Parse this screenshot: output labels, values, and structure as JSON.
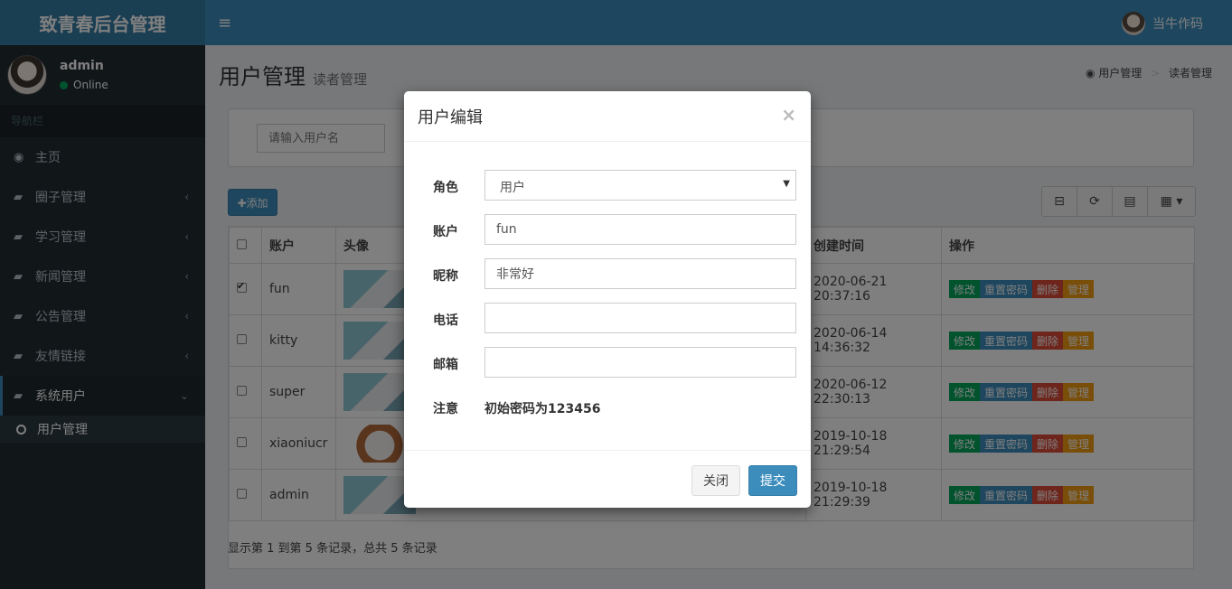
{
  "app": {
    "logo": "致青春后台管理",
    "top_user": "当牛作码"
  },
  "sidebar": {
    "user_name": "admin",
    "user_status": "Online",
    "nav_header": "导航栏",
    "items": [
      {
        "label": "主页",
        "icon": "dashboard-icon"
      },
      {
        "label": "圈子管理",
        "icon": "book-icon"
      },
      {
        "label": "学习管理",
        "icon": "book-icon"
      },
      {
        "label": "新闻管理",
        "icon": "book-icon"
      },
      {
        "label": "公告管理",
        "icon": "book-icon"
      },
      {
        "label": "友情链接",
        "icon": "book-icon"
      },
      {
        "label": "系统用户",
        "icon": "book-icon"
      }
    ],
    "sub_item": "用户管理"
  },
  "page": {
    "title": "用户管理",
    "subtitle": "读者管理",
    "breadcrumb": [
      "用户管理",
      "读者管理"
    ],
    "search_placeholder": "请输入用户名",
    "add_label": "✚添加"
  },
  "table": {
    "headers": [
      "账户",
      "头像",
      "创建时间",
      "操作"
    ],
    "rows": [
      {
        "account": "fun",
        "created": "2020-06-21 20:37:16",
        "checked": true
      },
      {
        "account": "kitty",
        "created": "2020-06-14 14:36:32",
        "checked": false
      },
      {
        "account": "super",
        "created": "2020-06-12 22:30:13",
        "checked": false
      },
      {
        "account": "xiaoniucr",
        "created": "2019-10-18 21:29:54",
        "checked": false
      },
      {
        "account": "admin",
        "created": "2019-10-18 21:29:39",
        "checked": false
      }
    ],
    "ops": [
      "修改",
      "重置密码",
      "删除",
      "管理"
    ],
    "footer": "显示第 1 到第 5 条记录，总共 5 条记录"
  },
  "modal": {
    "title": "用户编辑",
    "close_symbol": "×",
    "role_label": "角色",
    "role_value": "用户",
    "account_label": "账户",
    "account_value": "fun",
    "nickname_label": "昵称",
    "nickname_value": "非常好",
    "phone_label": "电话",
    "phone_value": "",
    "email_label": "邮箱",
    "email_value": "",
    "note_label": "注意",
    "note_text": "初始密码为123456",
    "btn_close": "关闭",
    "btn_submit": "提交"
  }
}
